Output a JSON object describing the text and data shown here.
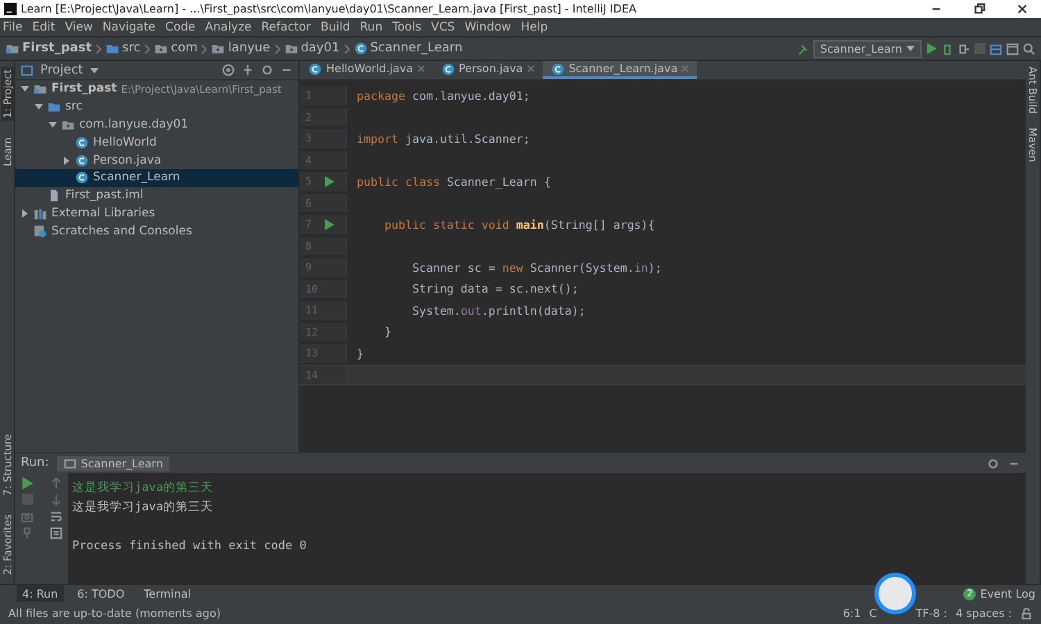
{
  "window": {
    "title": "Learn [E:\\Project\\Java\\Learn] - ...\\First_past\\src\\com\\lanyue\\day01\\Scanner_Learn.java [First_past] - IntelliJ IDEA"
  },
  "menu": [
    "File",
    "Edit",
    "View",
    "Navigate",
    "Code",
    "Analyze",
    "Refactor",
    "Build",
    "Run",
    "Tools",
    "VCS",
    "Window",
    "Help"
  ],
  "breadcrumbs": [
    {
      "label": "First_past",
      "kind": "module"
    },
    {
      "label": "src",
      "kind": "folder"
    },
    {
      "label": "com",
      "kind": "package"
    },
    {
      "label": "lanyue",
      "kind": "package"
    },
    {
      "label": "day01",
      "kind": "package"
    },
    {
      "label": "Scanner_Learn",
      "kind": "class"
    }
  ],
  "run_config": "Scanner_Learn",
  "left_strip": [
    {
      "label": "1: Project",
      "selected": true
    },
    {
      "label": "Learn",
      "selected": false
    }
  ],
  "left_strip_bottom": [
    "7: Structure",
    "2: Favorites"
  ],
  "right_strip": [
    "Ant Build",
    "Maven"
  ],
  "project_panel": {
    "title": "Project",
    "tree": [
      {
        "label": "First_past",
        "hint": "E:\\Project\\Java\\Learn\\First_past",
        "kind": "module",
        "expanded": true,
        "selected": false,
        "children": [
          {
            "label": "src",
            "kind": "folder",
            "expanded": true,
            "selected": false,
            "children": [
              {
                "label": "com.lanyue.day01",
                "kind": "package",
                "expanded": true,
                "selected": false,
                "children": [
                  {
                    "label": "HelloWorld",
                    "kind": "class",
                    "selected": false
                  },
                  {
                    "label": "Person.java",
                    "kind": "class",
                    "expanded": false,
                    "selected": false
                  },
                  {
                    "label": "Scanner_Learn",
                    "kind": "class",
                    "selected": true
                  }
                ]
              }
            ]
          },
          {
            "label": "First_past.iml",
            "kind": "file",
            "selected": false
          }
        ]
      },
      {
        "label": "External Libraries",
        "kind": "library",
        "expanded": false,
        "selected": false
      },
      {
        "label": "Scratches and Consoles",
        "kind": "scratches",
        "selected": false
      }
    ]
  },
  "editor_tabs": [
    {
      "label": "HelloWorld.java",
      "selected": false
    },
    {
      "label": "Person.java",
      "selected": false
    },
    {
      "label": "Scanner_Learn.java",
      "selected": true
    }
  ],
  "code": [
    {
      "num": "1",
      "run": false,
      "tokens": [
        {
          "t": "package ",
          "kind": "keyword"
        },
        {
          "t": "com.lanyue.day01;",
          "kind": "plain"
        }
      ]
    },
    {
      "num": "2",
      "run": false
    },
    {
      "num": "3",
      "run": false,
      "tokens": [
        {
          "t": "import ",
          "kind": "keyword"
        },
        {
          "t": "java.util.Scanner;",
          "kind": "plain"
        }
      ]
    },
    {
      "num": "4",
      "run": false
    },
    {
      "num": "5",
      "run": true,
      "tokens": [
        {
          "t": "public class ",
          "kind": "keyword"
        },
        {
          "t": "Scanner_Learn {",
          "kind": "plain"
        }
      ]
    },
    {
      "num": "6",
      "run": false
    },
    {
      "num": "7",
      "run": true,
      "tokens": [
        {
          "t": "    public static void ",
          "kind": "keyword"
        },
        {
          "t": "main",
          "kind": "method"
        },
        {
          "t": "(String[] args){",
          "kind": "plain"
        }
      ]
    },
    {
      "num": "8",
      "run": false
    },
    {
      "num": "9",
      "run": false,
      "tokens": [
        {
          "t": "        Scanner sc = ",
          "kind": "plain"
        },
        {
          "t": "new ",
          "kind": "keyword"
        },
        {
          "t": "Scanner(System.",
          "kind": "plain"
        },
        {
          "t": "in",
          "kind": "field"
        },
        {
          "t": ");",
          "kind": "plain"
        }
      ]
    },
    {
      "num": "10",
      "run": false,
      "tokens": [
        {
          "t": "        String data = sc.next();",
          "kind": "plain"
        }
      ]
    },
    {
      "num": "11",
      "run": false,
      "tokens": [
        {
          "t": "        System.",
          "kind": "plain"
        },
        {
          "t": "out",
          "kind": "field"
        },
        {
          "t": ".println(data);",
          "kind": "plain"
        }
      ]
    },
    {
      "num": "12",
      "run": false,
      "tokens": [
        {
          "t": "    }",
          "kind": "plain"
        }
      ]
    },
    {
      "num": "13",
      "run": false,
      "tokens": [
        {
          "t": "}",
          "kind": "plain"
        }
      ]
    },
    {
      "num": "14",
      "run": false,
      "current": true
    }
  ],
  "run_panel": {
    "label": "Run:",
    "tab": "Scanner_Learn",
    "console": [
      {
        "text": "这是我学习java的第三天",
        "kind": "input"
      },
      {
        "text": "这是我学习java的第三天",
        "kind": "output"
      },
      {
        "kind": "blank"
      },
      {
        "text": "Process finished with exit code 0",
        "kind": "output"
      }
    ]
  },
  "bottom_tabs": [
    {
      "label": "4: Run",
      "selected": true
    },
    {
      "label": "6: TODO",
      "selected": false
    },
    {
      "label": "Terminal",
      "selected": false
    }
  ],
  "event_log": {
    "label": "Event Log",
    "count": "2"
  },
  "status_bar": {
    "message": "All files are up-to-date (moments ago)",
    "items": [
      "6:1",
      "C",
      "TF-8 :",
      "4 spaces :"
    ]
  }
}
